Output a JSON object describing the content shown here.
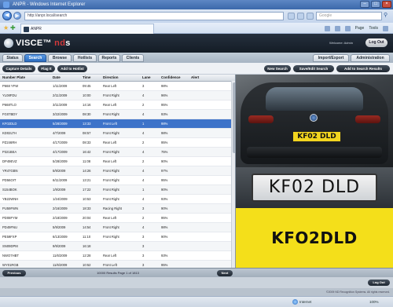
{
  "browser": {
    "title": "ANPR - Windows Internet Explorer",
    "address": "http://anpr.local/search",
    "search_placeholder": "Google",
    "tab_label": "ANPR",
    "commands": [
      "Page",
      "Tools"
    ],
    "status_zone": "Internet",
    "status_zoom": "100%"
  },
  "app": {
    "logo_a": "VISCE",
    "logo_b": "nd",
    "logo_c": "s",
    "welcome": "Welcome: Admin",
    "logout_label": "Log Out",
    "tabs": [
      "Status",
      "Search",
      "Browse",
      "Hotlists",
      "Reports",
      "Clients"
    ],
    "active_tab": "Search",
    "right_actions": [
      "Import/Export",
      "Administration"
    ],
    "left_actions": [
      "Capture Details",
      "Flag It",
      "Add to Hotlist"
    ],
    "search_actions": [
      "New Search",
      "Save/Edit Search",
      "Add to Search Results"
    ]
  },
  "table": {
    "columns": [
      "Number Plate",
      "Date",
      "Time",
      "Direction",
      "Lane",
      "Confidence",
      "Alert"
    ],
    "rows": [
      [
        "P668 YFW",
        "1/11/2009",
        "09:45",
        "Rear Left",
        "3",
        "98%",
        ""
      ],
      [
        "YL08FDU",
        "2/11/2009",
        "10:00",
        "Front Right",
        "4",
        "96%",
        ""
      ],
      [
        "P668TLO",
        "3/11/2009",
        "14:16",
        "Rear Left",
        "2",
        "95%",
        ""
      ],
      [
        "FG07BDY",
        "3/22/2009",
        "08:30",
        "Front Right",
        "4",
        "93%",
        ""
      ],
      [
        "KF02DLD",
        "5/28/2009",
        "13:33",
        "Front Left",
        "1",
        "98%",
        ""
      ],
      [
        "KD02LTH",
        "4/7/2009",
        "08:57",
        "Front Right",
        "4",
        "98%",
        ""
      ],
      [
        "PZ246RH",
        "4/17/2009",
        "08:33",
        "Rear Left",
        "2",
        "95%",
        ""
      ],
      [
        "P321BEA",
        "4/17/2009",
        "16:42",
        "Front Right",
        "4",
        "75%",
        ""
      ],
      [
        "DP49EVZ",
        "5/28/2009",
        "11:08",
        "Rear Left",
        "2",
        "90%",
        ""
      ],
      [
        "YR47GBN",
        "5/9/2009",
        "14:26",
        "Front Right",
        "4",
        "97%",
        ""
      ],
      [
        "PD56OIT",
        "6/11/2009",
        "13:21",
        "Front Right",
        "4",
        "95%",
        ""
      ],
      [
        "S154BOK",
        "1/9/2009",
        "17:22",
        "Front Right",
        "1",
        "90%",
        ""
      ],
      [
        "YB22WNH",
        "1/24/2009",
        "10:53",
        "Front Right",
        "4",
        "93%",
        ""
      ],
      [
        "PU59FWN",
        "2/16/2009",
        "18:33",
        "Racing Right",
        "3",
        "90%",
        ""
      ],
      [
        "PD08FYM",
        "2/18/2009",
        "20:04",
        "Rear Left",
        "2",
        "95%",
        ""
      ],
      [
        "PD49FNU",
        "5/9/2009",
        "14:54",
        "Front Right",
        "4",
        "98%",
        ""
      ],
      [
        "PE59FXP",
        "6/13/2009",
        "11:10",
        "Front Right",
        "3",
        "90%",
        ""
      ],
      [
        "SN09DPM",
        "9/9/2009",
        "16:18",
        "",
        "3",
        "",
        ""
      ],
      [
        "NWO7HBT",
        "11/6/2009",
        "12:28",
        "Rear Left",
        "3",
        "93%",
        ""
      ],
      [
        "WY01RGB",
        "11/6/2009",
        "10:52",
        "Front Left",
        "3",
        "95%",
        ""
      ]
    ],
    "selected_row": 4
  },
  "viewer": {
    "small_plate": "KF02 DLD",
    "zoom_plate": "KF02 DLD",
    "read_text": "KFO2DLD",
    "accent_yellow": "#f4df1a",
    "plate_yellow": "#f2d51f"
  },
  "footer": {
    "prev_label": "Previous",
    "next_label": "Next",
    "results_text": "10000 Results  Page 1 of 1813",
    "logout_label": "Log Out",
    "copyright": "©2009 ND Recognition Systems. All rights reserved."
  }
}
